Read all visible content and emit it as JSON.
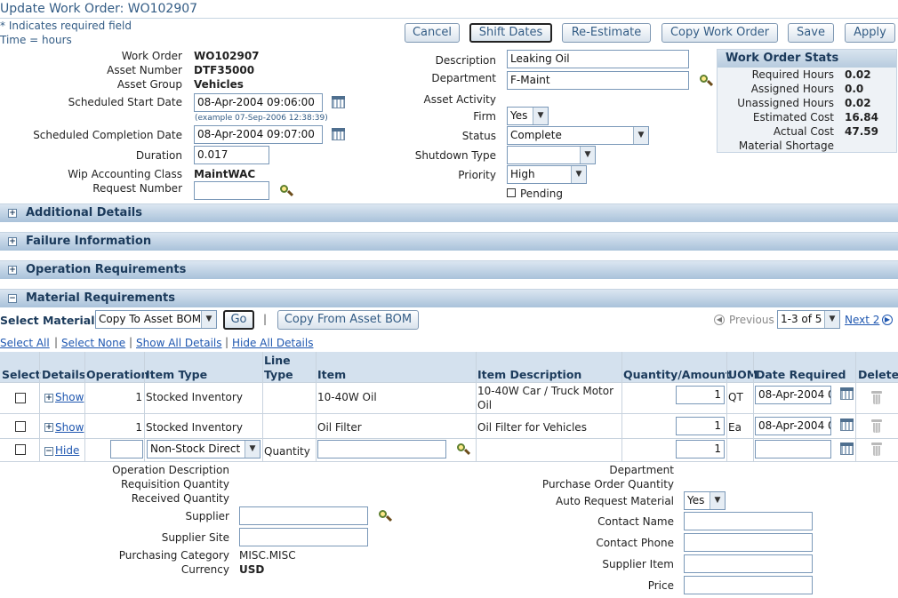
{
  "page_title": "Update Work Order: WO102907",
  "notes": {
    "required": "* Indicates required field",
    "time": "Time = hours"
  },
  "buttons": {
    "cancel": "Cancel",
    "shift_dates": "Shift Dates",
    "re_estimate": "Re-Estimate",
    "copy_work_order": "Copy Work Order",
    "save": "Save",
    "apply": "Apply"
  },
  "left_form": {
    "work_order_label": "Work Order",
    "work_order": "WO102907",
    "asset_number_label": "Asset Number",
    "asset_number": "DTF35000",
    "asset_group_label": "Asset Group",
    "asset_group": "Vehicles",
    "sched_start_label": "Scheduled Start Date",
    "sched_start": "08-Apr-2004 09:06:00",
    "date_hint": "(example 07-Sep-2006 12:38:39)",
    "sched_completion_label": "Scheduled Completion Date",
    "sched_completion": "08-Apr-2004 09:07:00",
    "duration_label": "Duration",
    "duration": "0.017",
    "wip_label": "Wip Accounting Class",
    "wip": "MaintWAC",
    "request_number_label": "Request Number",
    "request_number": ""
  },
  "right_form": {
    "description_label": "Description",
    "description": "Leaking Oil",
    "department_label": "Department",
    "department": "F-Maint",
    "asset_activity_label": "Asset Activity",
    "firm_label": "Firm",
    "firm": "Yes",
    "status_label": "Status",
    "status": "Complete",
    "shutdown_label": "Shutdown Type",
    "shutdown": "",
    "priority_label": "Priority",
    "priority": "High",
    "pending_label": "Pending"
  },
  "stats": {
    "title": "Work Order Stats",
    "required_label": "Required Hours",
    "required": "0.02",
    "assigned_label": "Assigned Hours",
    "assigned": "0.0",
    "unassigned_label": "Unassigned Hours",
    "unassigned": "0.02",
    "estimated_label": "Estimated Cost",
    "estimated": "16.84",
    "actual_label": "Actual Cost",
    "actual": "47.59",
    "shortage_label": "Material Shortage"
  },
  "sections": {
    "additional": "Additional Details",
    "failure": "Failure Information",
    "operation": "Operation Requirements",
    "material": "Material Requirements"
  },
  "material": {
    "select_label": "Select Material:",
    "select_value": "Copy To Asset BOM",
    "go": "Go",
    "bar": "|",
    "copy_from": "Copy From Asset BOM",
    "previous": "Previous",
    "range": "1-3 of 5",
    "next": "Next 2",
    "select_all": "Select All",
    "select_none": "Select None",
    "show_all": "Show All Details",
    "hide_all": "Hide All Details"
  },
  "table": {
    "headers": {
      "select": "Select",
      "details": "Details",
      "operation": "Operation",
      "item_type": "Item Type",
      "line_type_1": "Line",
      "line_type_2": "Type",
      "item": "Item",
      "item_desc": "Item Description",
      "quantity": "Quantity/Amount",
      "uom": "UOM",
      "date_required": "Date Required",
      "delete": "Delete"
    },
    "rows": [
      {
        "details": "Show",
        "operation": "1",
        "item_type": "Stocked Inventory",
        "line_type": "",
        "item": "10-40W Oil",
        "desc_1": "10-40W Car / Truck Motor",
        "desc_2": "Oil",
        "quantity": "1",
        "uom": "QT",
        "date": "08-Apr-2004 0"
      },
      {
        "details": "Show",
        "operation": "1",
        "item_type": "Stocked Inventory",
        "line_type": "",
        "item": "Oil Filter",
        "desc_1": "Oil Filter for Vehicles",
        "desc_2": "",
        "quantity": "1",
        "uom": "Ea",
        "date": "08-Apr-2004 0"
      },
      {
        "details": "Hide",
        "operation": "",
        "item_type": "Non-Stock Direct",
        "line_type": "Quantity",
        "item": "",
        "desc_1": "",
        "desc_2": "",
        "quantity": "1",
        "uom": "",
        "date": ""
      }
    ]
  },
  "detail": {
    "op_desc_label": "Operation Description",
    "req_qty_label": "Requisition Quantity",
    "received_qty_label": "Received Quantity",
    "supplier_label": "Supplier",
    "supplier": "",
    "supplier_site_label": "Supplier Site",
    "supplier_site": "",
    "purch_cat_label": "Purchasing Category",
    "purch_cat": "MISC.MISC",
    "currency_label": "Currency",
    "currency": "USD",
    "department_label": "Department",
    "po_qty_label": "Purchase Order Quantity",
    "auto_req_label": "Auto Request Material",
    "auto_req": "Yes",
    "contact_name_label": "Contact Name",
    "contact_name": "",
    "contact_phone_label": "Contact Phone",
    "contact_phone": "",
    "supplier_item_label": "Supplier Item",
    "supplier_item": "",
    "price_label": "Price",
    "price": ""
  }
}
